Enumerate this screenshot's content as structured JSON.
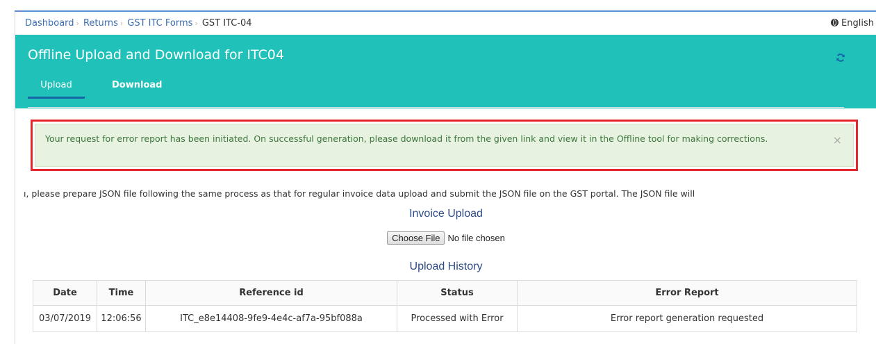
{
  "breadcrumb": {
    "items": [
      "Dashboard",
      "Returns",
      "GST ITC Forms"
    ],
    "current": "GST ITC-04"
  },
  "language": {
    "label": "English",
    "icon": "globe-icon"
  },
  "header": {
    "title": "Offline Upload and Download for ITC04",
    "refresh_icon": "refresh-icon",
    "tabs": [
      {
        "label": "Upload",
        "active": true
      },
      {
        "label": "Download",
        "active": false
      }
    ]
  },
  "alert": {
    "message": "Your request for error report has been initiated. On successful generation, please download it from the given link and view it in the Offline tool for making corrections.",
    "close_icon": "close-icon",
    "close_label": "×"
  },
  "info_text": "ı, please prepare JSON file following the same process as that for regular invoice data upload and submit the JSON file on the GST portal. The JSON file will",
  "upload": {
    "title": "Invoice Upload",
    "choose_button": "Choose File",
    "file_status": "No file chosen"
  },
  "history": {
    "title": "Upload History",
    "columns": [
      "Date",
      "Time",
      "Reference id",
      "Status",
      "Error Report"
    ],
    "rows": [
      [
        "03/07/2019",
        "12:06:56",
        "ITC_e8e14408-9fe9-4e4c-af7a-95bf088a",
        "Processed with Error",
        "Error report generation requested"
      ]
    ]
  },
  "colors": {
    "header_bg": "#1fc1b8",
    "alert_bg": "#e8f2e0",
    "alert_text": "#3c763d",
    "highlight_border": "#e6262e",
    "link": "#3a6db5",
    "active_tab_underline": "#1565a8"
  }
}
